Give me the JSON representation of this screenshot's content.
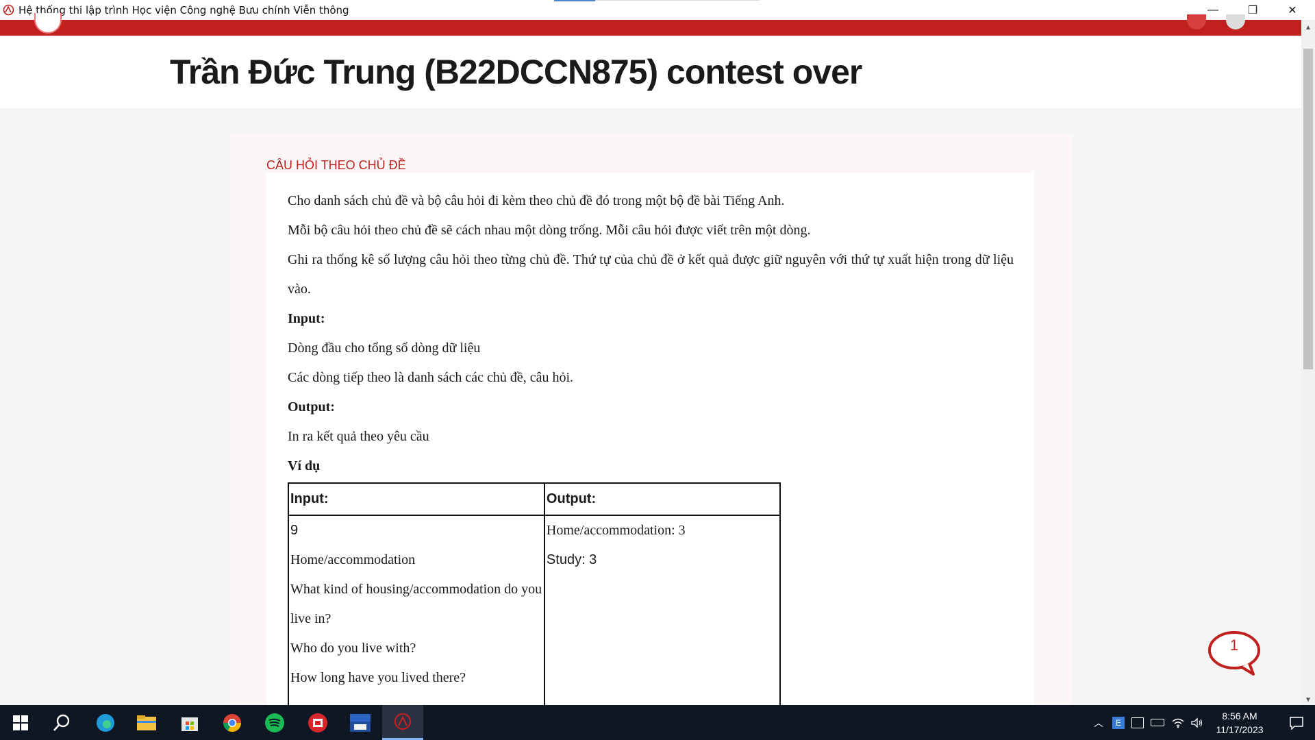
{
  "window": {
    "title": "Hệ thống thi lập trình Học viện Công nghệ Bưu chính Viễn thông",
    "controls": {
      "minimize": "—",
      "restore": "❐",
      "close": "✕"
    }
  },
  "page": {
    "title": "Trần Đức Trung (B22DCCN875)  contest over"
  },
  "problem": {
    "section_heading": "CÂU HỎI THEO CHỦ ĐỀ",
    "paragraphs": [
      "Cho danh  sách chủ đề và bộ câu hỏi đi kèm theo chủ đề đó trong một bộ đề bài Tiếng Anh.",
      "Mỗi bộ câu hỏi theo chủ đề sẽ cách nhau một dòng trống. Mỗi câu hỏi được viết trên một dòng.",
      "Ghi ra thống kê số lượng câu hỏi theo từng chủ đề. Thứ tự của chủ đề ở kết quả được giữ nguyên với thứ tự xuất hiện trong dữ liệu vào."
    ],
    "input_heading": "Input:",
    "input_lines": [
      "Dòng đầu cho tổng số dòng dữ liệu",
      "Các dòng tiếp theo là danh sách các chủ đề, câu hỏi."
    ],
    "output_heading": "Output:",
    "output_lines": [
      "In ra kết quả theo yêu cầu"
    ],
    "example_heading": "Ví dụ",
    "example": {
      "input_header": "Input:",
      "output_header": "Output:",
      "input_lines": [
        "9",
        "Home/accommodation",
        "What kind of housing/accommodation do you live in?",
        "Who do you live with?",
        "How long have you lived there?"
      ],
      "output_lines": [
        "Home/accommodation: 3",
        "Study: 3"
      ]
    }
  },
  "chat": {
    "badge_count": "1",
    "color": "#c0211f"
  },
  "taskbar": {
    "apps": [
      "start-icon",
      "search-icon",
      "edge-icon",
      "file-explorer-icon",
      "store-icon",
      "chrome-icon",
      "spotify-icon",
      "office-icon",
      "devcpp-icon",
      "ptit-app-icon"
    ],
    "time": "8:56 AM",
    "date": "11/17/2023"
  },
  "colors": {
    "accent_red": "#c0211f",
    "taskbar_bg": "#0f1624"
  }
}
